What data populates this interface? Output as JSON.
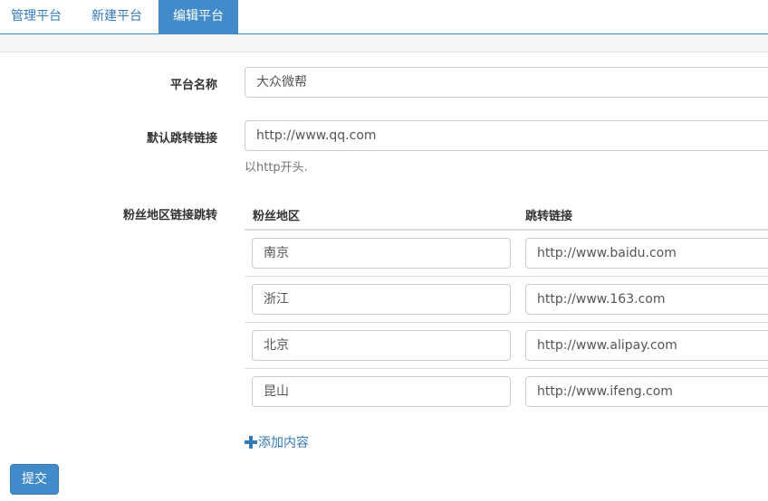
{
  "tabs": [
    {
      "label": "管理平台"
    },
    {
      "label": "新建平台"
    },
    {
      "label": "编辑平台"
    }
  ],
  "form": {
    "platform_name_label": "平台名称",
    "platform_name_value": "大众微帮",
    "default_link_label": "默认跳转链接",
    "default_link_value": "http://www.qq.com",
    "default_link_help": "以http开头.",
    "region_links_label": "粉丝地区链接跳转",
    "table": {
      "headers": [
        "粉丝地区",
        "跳转链接"
      ],
      "rows": [
        {
          "region": "南京",
          "link": "http://www.baidu.com"
        },
        {
          "region": "浙江",
          "link": "http://www.163.com"
        },
        {
          "region": "北京",
          "link": "http://www.alipay.com"
        },
        {
          "region": "昆山",
          "link": "http://www.ifeng.com"
        }
      ]
    },
    "add_content_label": "添加内容",
    "submit_label": "提交"
  },
  "colors": {
    "accent": "#428bca",
    "link": "#337ab7"
  }
}
